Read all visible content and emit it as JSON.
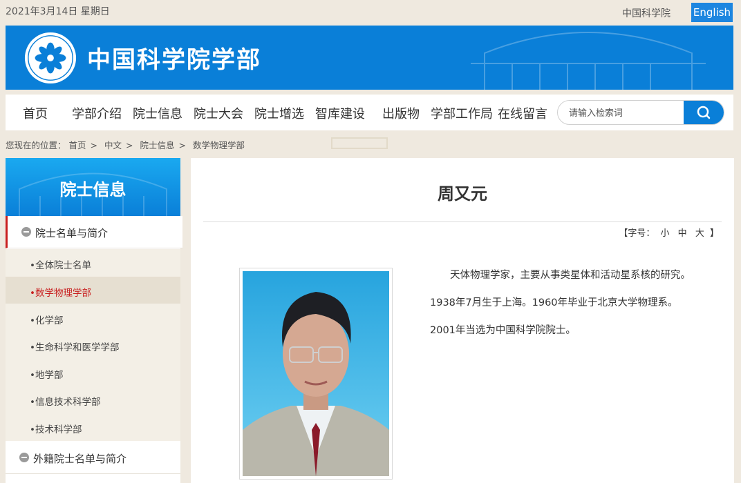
{
  "top": {
    "date": "2021年3月14日 星期日",
    "cas_link": "中国科学院",
    "english": "English"
  },
  "banner": {
    "title": "中国科学院学部"
  },
  "nav": {
    "items": [
      "首页",
      "学部介绍",
      "院士信息",
      "院士大会",
      "院士增选",
      "智库建设",
      "出版物",
      "学部工作局",
      "在线留言"
    ],
    "search_placeholder": "请输入检索词"
  },
  "breadcrumb": {
    "label": "您现在的位置：",
    "items": [
      "首页",
      "中文",
      "院士信息",
      "数学物理学部"
    ]
  },
  "sidebar": {
    "title": "院士信息",
    "section1": "院士名单与简介",
    "items": [
      "•全体院士名单",
      "•数学物理学部",
      "•化学部",
      "•生命科学和医学学部",
      "•地学部",
      "•信息技术科学部",
      "•技术科学部"
    ],
    "section2": "外籍院士名单与简介"
  },
  "article": {
    "title": "周又元",
    "fontsize_label": "【字号：",
    "fontsize_small": "小",
    "fontsize_medium": "中",
    "fontsize_large": "大",
    "fontsize_end": "】",
    "bio": [
      "　　天体物理学家，主要从事类星体和活动星系核的研究。",
      "1938年7月生于上海。1960年毕业于北京大学物理系。",
      "2001年当选为中国科学院院士。"
    ]
  },
  "colors": {
    "primary_blue": "#0a7fd8",
    "accent_red": "#c81e1e",
    "page_bg": "#efe9df"
  }
}
